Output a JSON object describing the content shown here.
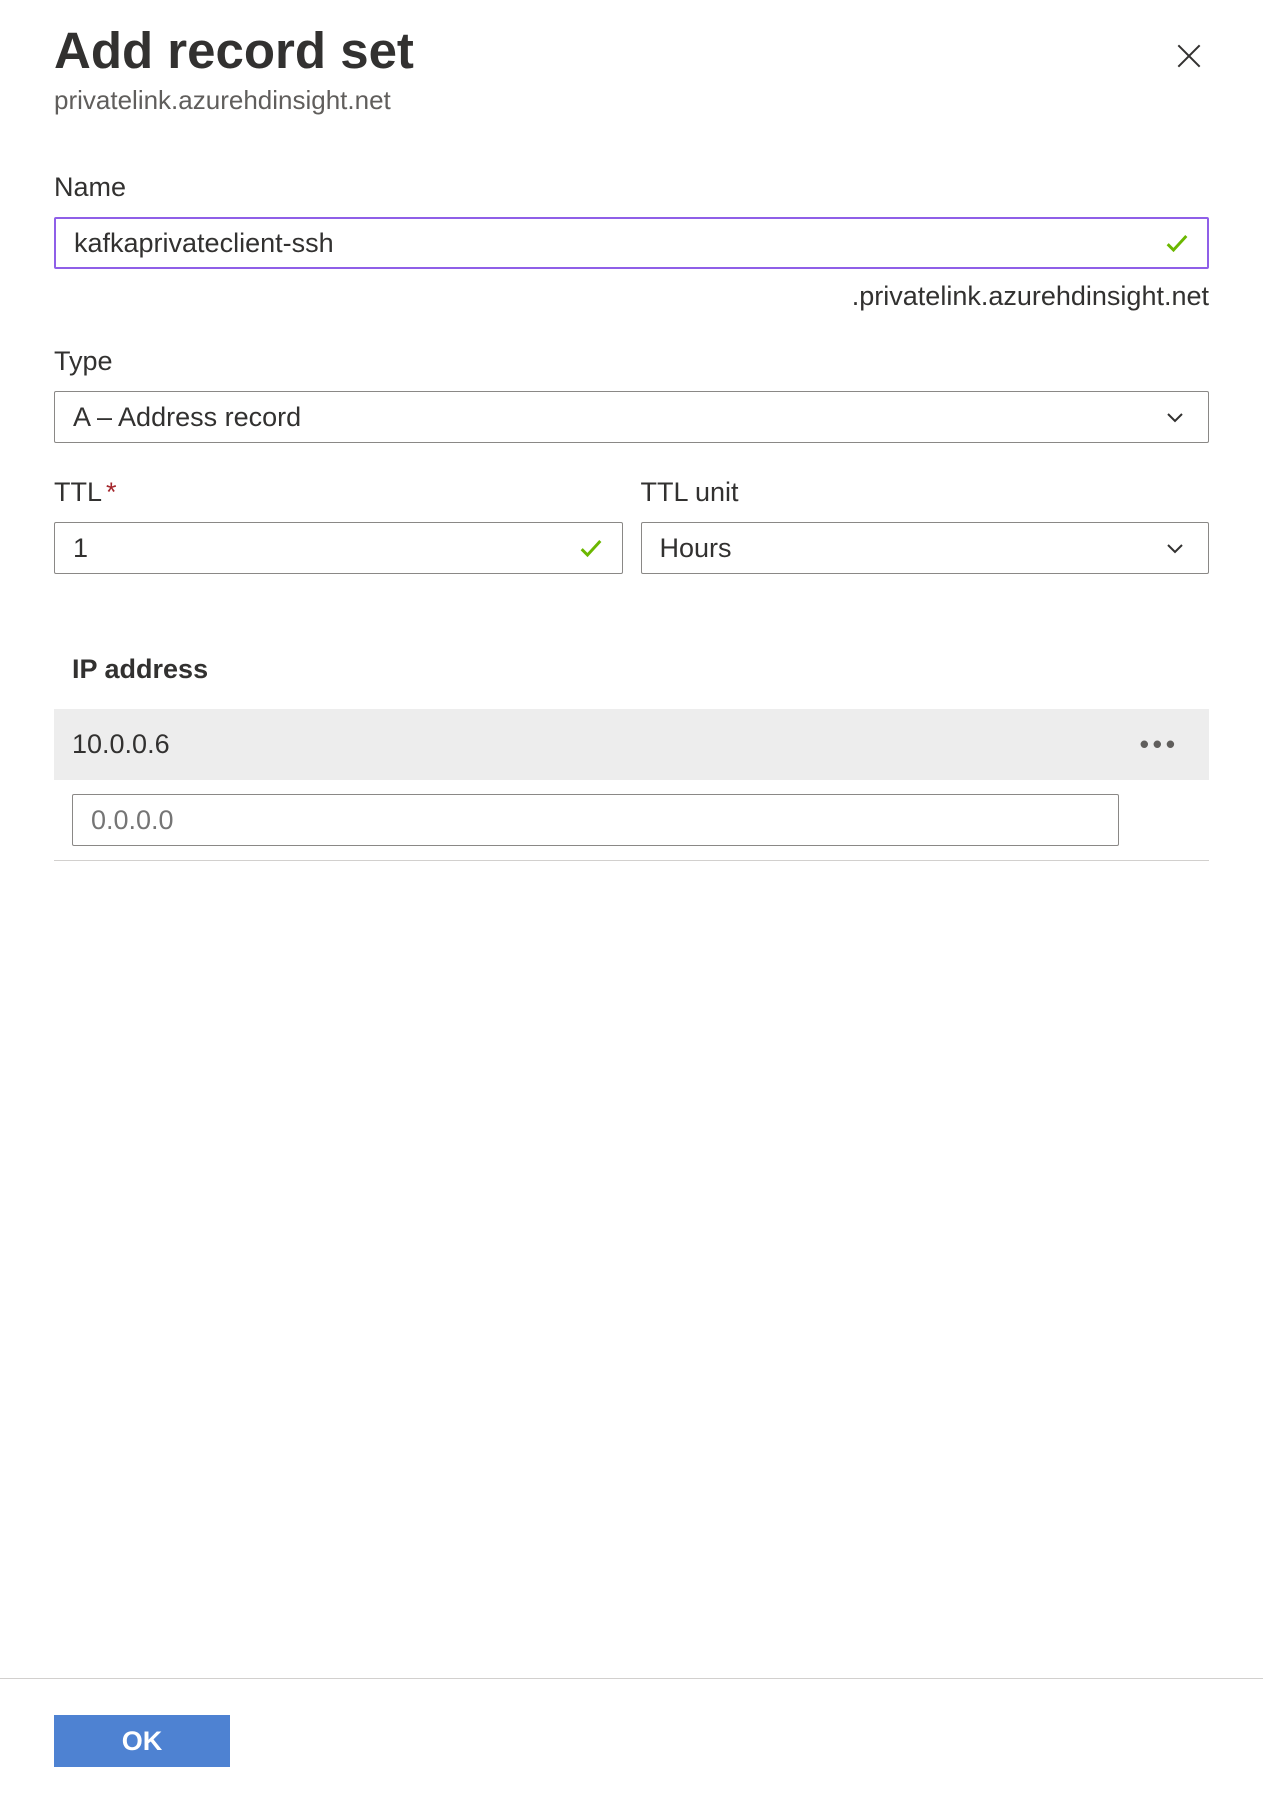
{
  "header": {
    "title": "Add record set",
    "subtitle": "privatelink.azurehdinsight.net"
  },
  "fields": {
    "name": {
      "label": "Name",
      "value": "kafkaprivateclient-ssh",
      "suffix": ".privatelink.azurehdinsight.net"
    },
    "type": {
      "label": "Type",
      "value": "A – Address record"
    },
    "ttl": {
      "label": "TTL",
      "value": "1"
    },
    "ttl_unit": {
      "label": "TTL unit",
      "value": "Hours"
    },
    "ip": {
      "header": "IP address",
      "entries": [
        "10.0.0.6"
      ],
      "placeholder": "0.0.0.0"
    }
  },
  "footer": {
    "ok_label": "OK"
  }
}
